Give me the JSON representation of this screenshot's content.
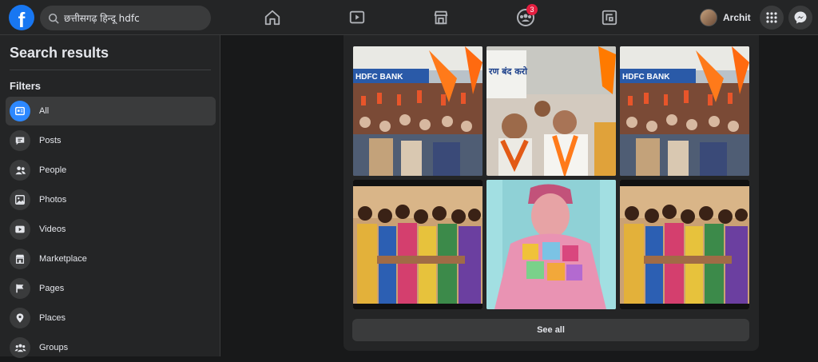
{
  "topbar": {
    "search_value": "छत्तीसगढ़ हिन्दू hdfc",
    "notification_count": "3",
    "profile_name": "Archit"
  },
  "sidebar": {
    "title": "Search results",
    "filters_label": "Filters",
    "items": [
      {
        "label": "All",
        "icon": "all-icon",
        "active": true
      },
      {
        "label": "Posts",
        "icon": "posts-icon"
      },
      {
        "label": "People",
        "icon": "people-icon"
      },
      {
        "label": "Photos",
        "icon": "photos-icon"
      },
      {
        "label": "Videos",
        "icon": "videos-icon"
      },
      {
        "label": "Marketplace",
        "icon": "marketplace-icon"
      },
      {
        "label": "Pages",
        "icon": "pages-icon"
      },
      {
        "label": "Places",
        "icon": "places-icon"
      },
      {
        "label": "Groups",
        "icon": "groups-icon"
      }
    ]
  },
  "photos": {
    "see_all_label": "See all",
    "sign_banner_text": "HDFC BANK",
    "placard_text": "रण बंद करो"
  },
  "colors": {
    "accent": "#2d88ff",
    "brand": "#1877f2",
    "badge": "#e41e3f",
    "background": "#18191a",
    "surface": "#242526"
  }
}
